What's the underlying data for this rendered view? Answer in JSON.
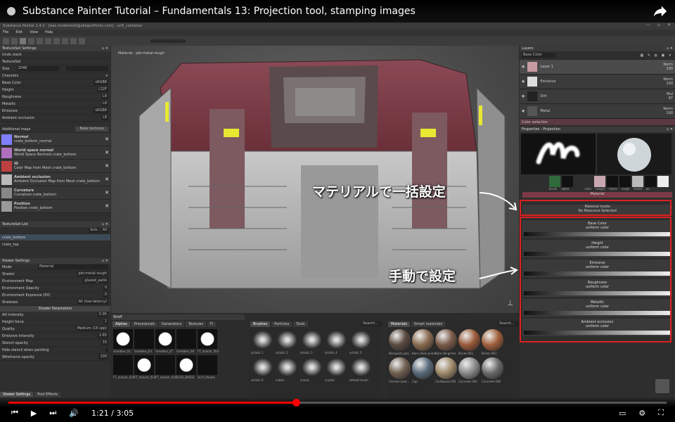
{
  "video": {
    "title": "Substance Painter Tutorial – Fundamentals 13: Projection tool, stamping images",
    "time": "1:21 / 3:05",
    "progress": 0.437
  },
  "app": {
    "title": "Substance Painter 1.4.2 - [wes.mcdermott@allegorithmic.com] - scifi_container"
  },
  "menu": [
    "File",
    "Edit",
    "View",
    "Help"
  ],
  "left": {
    "title": "TextureSet Settings",
    "undo": "Undo stack",
    "textureset": "TextureSet",
    "size_label": "Size",
    "size_value": "2048",
    "channels_label": "Channels",
    "channels": [
      {
        "name": "Base Color",
        "fmt": "sRGB8"
      },
      {
        "name": "Height",
        "fmt": "L32F"
      },
      {
        "name": "Roughness",
        "fmt": "L8"
      },
      {
        "name": "Metallic",
        "fmt": "L8"
      },
      {
        "name": "Emissive",
        "fmt": "sRGB8"
      },
      {
        "name": "Ambient occlusion",
        "fmt": "L8"
      }
    ],
    "additional": "Additional maps",
    "bake": "Bake textures",
    "maps": [
      {
        "name": "Normal",
        "sub": "crate_bottom_normal",
        "color": "#8080ff"
      },
      {
        "name": "World space normal",
        "sub": "World Space Normals crate_bottom",
        "color": "#b070c0"
      },
      {
        "name": "ID",
        "sub": "Color Map from Mesh crate_bottom",
        "color": "#c04040"
      },
      {
        "name": "Ambient occlusion",
        "sub": "Ambient Occlusion Map from Mesh crate_bottom",
        "color": "#bbbbbb"
      },
      {
        "name": "Curvature",
        "sub": "Curvature crate_bottom",
        "color": "#888888"
      },
      {
        "name": "Position",
        "sub": "Position crate_bottom",
        "color": "#999999"
      }
    ],
    "tslist": "TextureSet List",
    "tabs": [
      "Solo",
      "All"
    ],
    "tsitems": [
      "crate_bottom",
      "crate_top"
    ],
    "viewer": "Viewer Settings",
    "mode_label": "Mode",
    "mode_value": "Material",
    "viewer_rows": [
      {
        "k": "Shader",
        "v": "pbr-metal-rough"
      },
      {
        "k": "Environment Map",
        "v": "glazed_patio"
      },
      {
        "k": "Environment Opacity",
        "v": "0"
      },
      {
        "k": "Environment Exposure (EV)",
        "v": "0"
      },
      {
        "k": "Shadows",
        "v": "All (low-latency)"
      }
    ],
    "shader_params": "Shader Parameters",
    "shader_rows": [
      {
        "k": "AO Intensity",
        "v": "0.95"
      },
      {
        "k": "Height force",
        "v": "1"
      },
      {
        "k": "Quality",
        "v": "Medium (16 spp)"
      },
      {
        "k": "Emissive Intensity",
        "v": "2.65"
      }
    ],
    "stencil_rows": [
      {
        "k": "Stencil opacity",
        "v": "33"
      },
      {
        "k": "Hide stencil when painting",
        "v": ""
      },
      {
        "k": "Wireframe opacity",
        "v": "100"
      }
    ],
    "bottom_tabs": [
      "Viewer Settings",
      "Post Effects"
    ]
  },
  "viewport": {
    "label": "Material - pbr-metal-rough"
  },
  "shelf": {
    "title": "Shelf",
    "tabs": [
      "Alphas",
      "Procedurals",
      "Generators",
      "Textures",
      "Fi"
    ],
    "alphas": [
      "Greebles_01",
      "Greebles_03",
      "Greebles_27",
      "Greebles_28",
      "FT_Industr_003",
      "FT_Industr_010",
      "FT_Industr_014",
      "FT_Industr_016",
      "SCIFI_DRESS",
      "Sci-fi_Panels"
    ],
    "brush_tabs": [
      "Brushes",
      "Particles",
      "Tools"
    ],
    "brushes": [
      "artistic 1",
      "artistic 2",
      "artistic 3",
      "artistic 4",
      "artistic 5",
      "artistic 6",
      "cotton",
      "cracks",
      "crystal",
      "default brush"
    ],
    "mat_tabs": [
      "Materials",
      "Smart materials"
    ],
    "materials": [
      "Backpack pad...",
      "Bare clean prime",
      "Bare old grime",
      "Bricks 001",
      "Bricks 003",
      "Carmen bast...",
      "Cap",
      "Cardboard 001",
      "Concrete 002",
      "Concrete 008"
    ],
    "search": "Search..."
  },
  "right": {
    "layers_title": "Layers",
    "channel": "Base Color",
    "layers": [
      {
        "name": "Layer 1",
        "blend": "Norm",
        "op": "100"
      },
      {
        "name": "Emissive",
        "blend": "Norm",
        "op": "100"
      },
      {
        "name": "Dirt",
        "blend": "Mul",
        "op": "97"
      },
      {
        "name": "Metal",
        "blend": "Norm",
        "op": "100"
      }
    ],
    "color_sel": "Color selection",
    "props_title": "Properties - Projection",
    "brush_labels": [
      "brush",
      "alpha"
    ],
    "mat_labels": [
      "color",
      "height",
      "emiss",
      "rough",
      "metal",
      "ao"
    ],
    "material": "Material",
    "material_mode": "Material mode",
    "no_resource": "No Resource Selected",
    "sections": [
      {
        "name": "Base Color",
        "sub": "uniform color"
      },
      {
        "name": "Height",
        "sub": "uniform color"
      },
      {
        "name": "Emissive",
        "sub": "uniform color"
      },
      {
        "name": "Roughness",
        "sub": "uniform color"
      },
      {
        "name": "Metallic",
        "sub": "uniform color"
      },
      {
        "name": "Ambient occlusion",
        "sub": "uniform color"
      }
    ]
  },
  "annotations": {
    "top": "マテリアルで一括設定",
    "bottom": "手動で設定"
  },
  "colors": {
    "accent": "#ff0000",
    "red_box": "#e02020",
    "crate_red": "#7a3a44"
  }
}
